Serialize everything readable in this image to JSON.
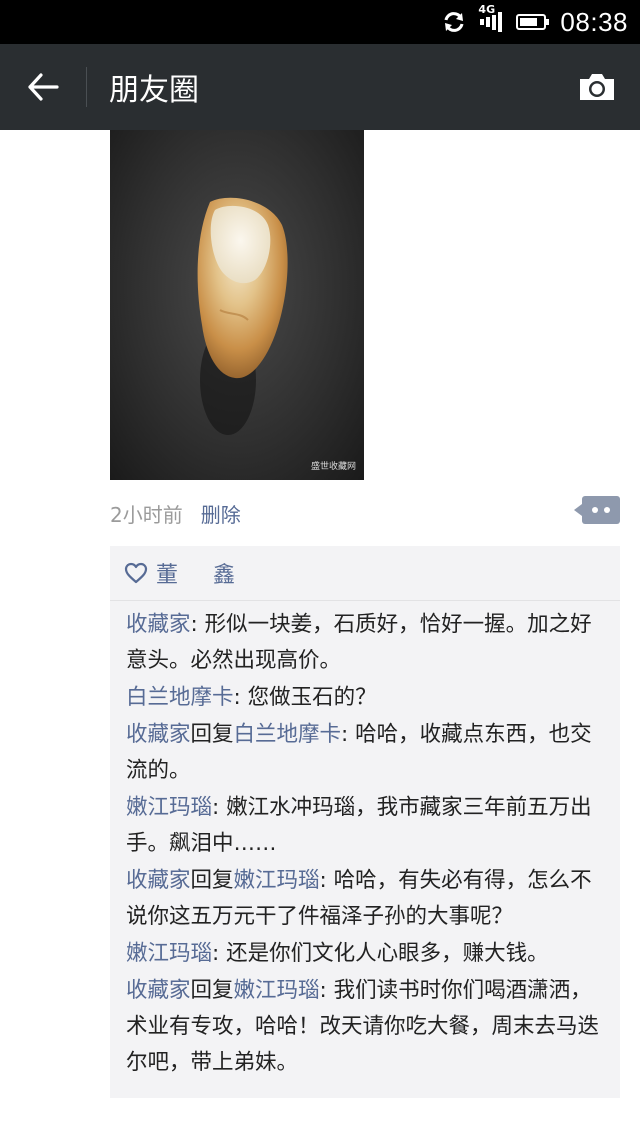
{
  "status_bar": {
    "network": "4G",
    "time": "08:38",
    "battery_level": 0.75
  },
  "header": {
    "title": "朋友圈"
  },
  "post": {
    "watermark": "盛世收藏网",
    "time": "2小时前",
    "delete_label": "删除"
  },
  "likes": [
    "董 鑫"
  ],
  "comments": [
    {
      "author": "收藏家",
      "reply_word": "",
      "reply_to": "",
      "text": ": 形似一块姜，石质好，恰好一握。加之好意头。必然出现高价。"
    },
    {
      "author": "白兰地摩卡",
      "reply_word": "",
      "reply_to": "",
      "text": ": 您做玉石的？"
    },
    {
      "author": "收藏家",
      "reply_word": "回复",
      "reply_to": "白兰地摩卡",
      "text": ": 哈哈，收藏点东西，也交流的。"
    },
    {
      "author": "嫩江玛瑙",
      "reply_word": "",
      "reply_to": "",
      "text": ": 嫩江水冲玛瑙，我市藏家三年前五万出手。飙泪中……"
    },
    {
      "author": "收藏家",
      "reply_word": "回复",
      "reply_to": "嫩江玛瑙",
      "text": ": 哈哈，有失必有得，怎么不说你这五万元干了件福泽子孙的大事呢？"
    },
    {
      "author": "嫩江玛瑙",
      "reply_word": "",
      "reply_to": "",
      "text": ": 还是你们文化人心眼多，赚大钱。"
    },
    {
      "author": "收藏家",
      "reply_word": "回复",
      "reply_to": "嫩江玛瑙",
      "text": ": 我们读书时你们喝酒潇洒，术业有专攻，哈哈！改天请你吃大餐，周末去马迭尔吧，带上弟妹。"
    }
  ],
  "colors": {
    "status_bar": "#000000",
    "title_bar": "#2a2e31",
    "link_blue": "#576b95",
    "comment_bg": "#f3f3f5"
  }
}
